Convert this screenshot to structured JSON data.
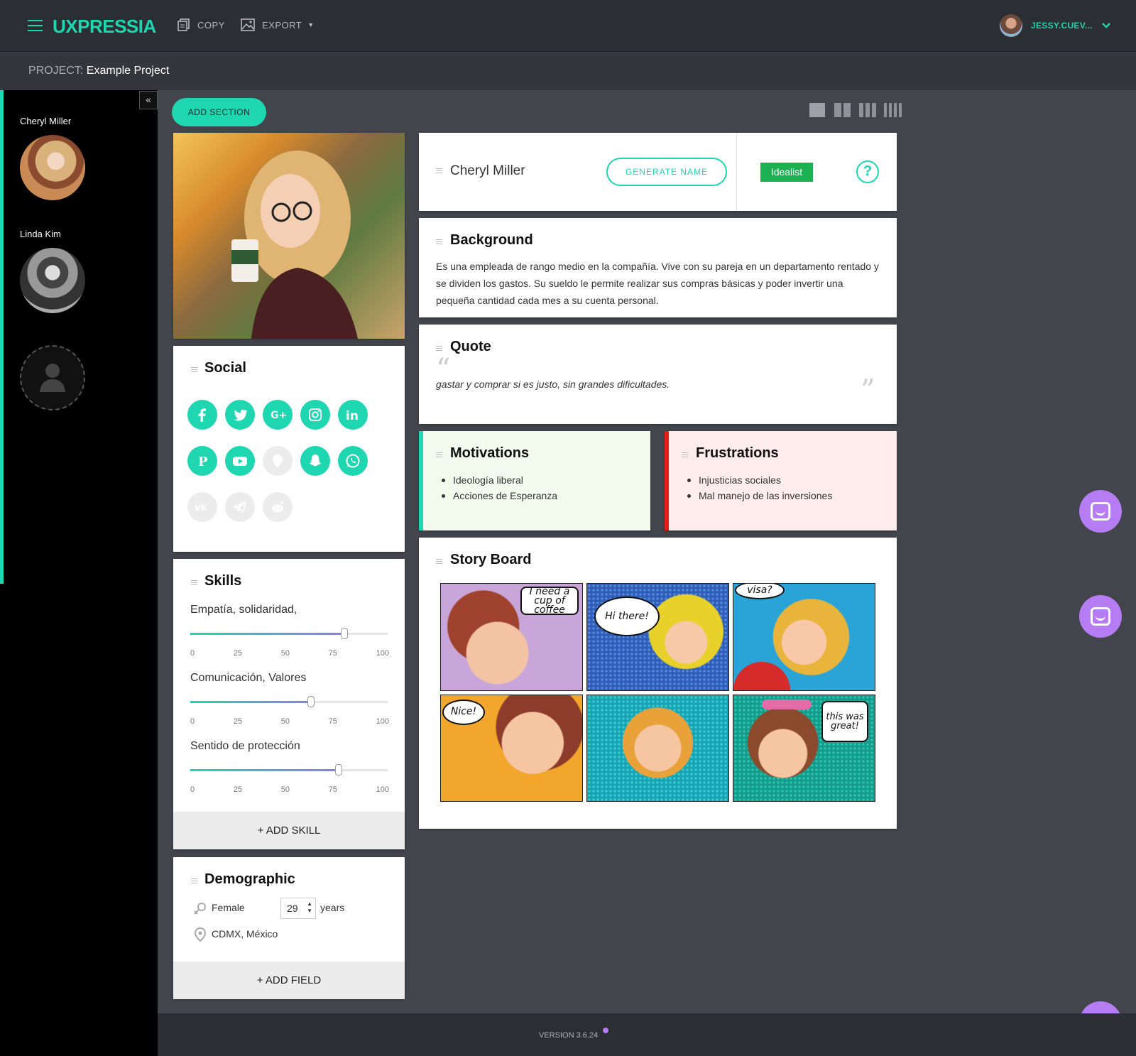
{
  "topbar": {
    "logo": "UXPRESSIA",
    "copy_label": "COPY",
    "export_label": "EXPORT",
    "user_name": "JESSY.CUEV..."
  },
  "project": {
    "label": "PROJECT:",
    "name": "Example Project"
  },
  "sidebar": {
    "collapse_icon": "«",
    "personas": [
      {
        "name": "Cheryl Miller"
      },
      {
        "name": "Linda Kim"
      }
    ]
  },
  "toolbar": {
    "add_section_label": "ADD SECTION"
  },
  "persona": {
    "name": "Cheryl Miller",
    "generate_name_label": "GENERATE NAME",
    "type_badge": "Idealist",
    "help_icon": "?"
  },
  "background": {
    "title": "Background",
    "text": "Es una empleada de rango medio en la compañía. Vive con su pareja en un departamento rentado y se dividen los gastos. Su sueldo le permite realizar sus compras básicas y poder invertir una pequeña cantidad cada mes a su cuenta personal."
  },
  "quote": {
    "title": "Quote",
    "open_mark": "“",
    "close_mark": "”",
    "text": "gastar y comprar si es justo, sin grandes dificultades."
  },
  "motivations": {
    "title": "Motivations",
    "items": [
      "Ideología liberal",
      "Acciones de Esperanza"
    ],
    "color": "#1ed6b0"
  },
  "frustrations": {
    "title": "Frustrations",
    "items": [
      "Injusticias sociales",
      "Mal manejo de las inversiones"
    ],
    "color": "#e31b1b"
  },
  "storyboard": {
    "title": "Story Board",
    "bubbles": [
      "I need a cup of coffee",
      "Hi there!",
      "visa?",
      "Nice!",
      "this was great!"
    ]
  },
  "social": {
    "title": "Social",
    "icons": [
      {
        "name": "facebook",
        "glyph": "f",
        "active": true
      },
      {
        "name": "twitter",
        "glyph": "t",
        "active": true
      },
      {
        "name": "google-plus",
        "glyph": "g+",
        "active": true
      },
      {
        "name": "instagram",
        "glyph": "ig",
        "active": true
      },
      {
        "name": "linkedin",
        "glyph": "in",
        "active": true
      },
      {
        "name": "pinterest",
        "glyph": "p",
        "active": true
      },
      {
        "name": "youtube",
        "glyph": "yt",
        "active": true
      },
      {
        "name": "foursquare",
        "glyph": "fs",
        "active": false
      },
      {
        "name": "snapchat",
        "glyph": "sc",
        "active": true
      },
      {
        "name": "whatsapp",
        "glyph": "wa",
        "active": true
      },
      {
        "name": "vk",
        "glyph": "vk",
        "active": false
      },
      {
        "name": "telegram",
        "glyph": "tg",
        "active": false
      },
      {
        "name": "reddit",
        "glyph": "rd",
        "active": false
      }
    ]
  },
  "skills": {
    "title": "Skills",
    "tick_labels": [
      "0",
      "25",
      "50",
      "75",
      "100"
    ],
    "items": [
      {
        "label": "Empatía, solidaridad,",
        "value": 78
      },
      {
        "label": "Comunicación, Valores",
        "value": 61
      },
      {
        "label": "Sentido de protección",
        "value": 75
      }
    ],
    "add_label": "+ ADD SKILL"
  },
  "demographic": {
    "title": "Demographic",
    "gender": "Female",
    "age": "29",
    "age_unit": "years",
    "location": "CDMX, México",
    "add_label": "+ ADD FIELD"
  },
  "footer": {
    "version": "VERSION 3.6.24"
  },
  "colors": {
    "accent": "#1ed6b0",
    "badge": "#1bb152",
    "chat": "#b67cf3"
  }
}
